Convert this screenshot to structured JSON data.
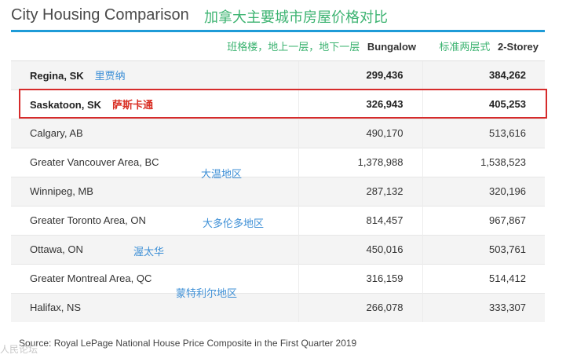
{
  "title": {
    "en": "City Housing Comparison",
    "cn": "加拿大主要城市房屋价格对比"
  },
  "table": {
    "headers": {
      "bungalow_cn": "班格楼，地上一层，地下一层",
      "bungalow_en": "Bungalow",
      "two_storey_cn": "标准两层式",
      "two_storey_en": "2-Storey"
    },
    "rows": [
      {
        "city": "Regina, SK",
        "bungalow": "299,436",
        "two_storey": "384,262",
        "note": "里贾纳"
      },
      {
        "city": "Saskatoon, SK",
        "bungalow": "326,943",
        "two_storey": "405,253",
        "note": "萨斯卡通"
      },
      {
        "city": "Calgary, AB",
        "bungalow": "490,170",
        "two_storey": "513,616"
      },
      {
        "city": "Greater Vancouver Area, BC",
        "bungalow": "1,378,988",
        "two_storey": "1,538,523"
      },
      {
        "city": "Winnipeg, MB",
        "bungalow": "287,132",
        "two_storey": "320,196"
      },
      {
        "city": "Greater Toronto Area, ON",
        "bungalow": "814,457",
        "two_storey": "967,867"
      },
      {
        "city": "Ottawa, ON",
        "bungalow": "450,016",
        "two_storey": "503,761"
      },
      {
        "city": "Greater Montreal Area, QC",
        "bungalow": "316,159",
        "two_storey": "514,412"
      },
      {
        "city": "Halifax, NS",
        "bungalow": "266,078",
        "two_storey": "333,307"
      }
    ]
  },
  "annotations": {
    "vancouver": "大温地区",
    "toronto": "大多伦多地区",
    "ottawa": "渥太华",
    "montreal": "蒙特利尔地区"
  },
  "source": "Source: Royal LePage National House Price Composite in the First Quarter 2019",
  "watermark": "人民论坛"
}
